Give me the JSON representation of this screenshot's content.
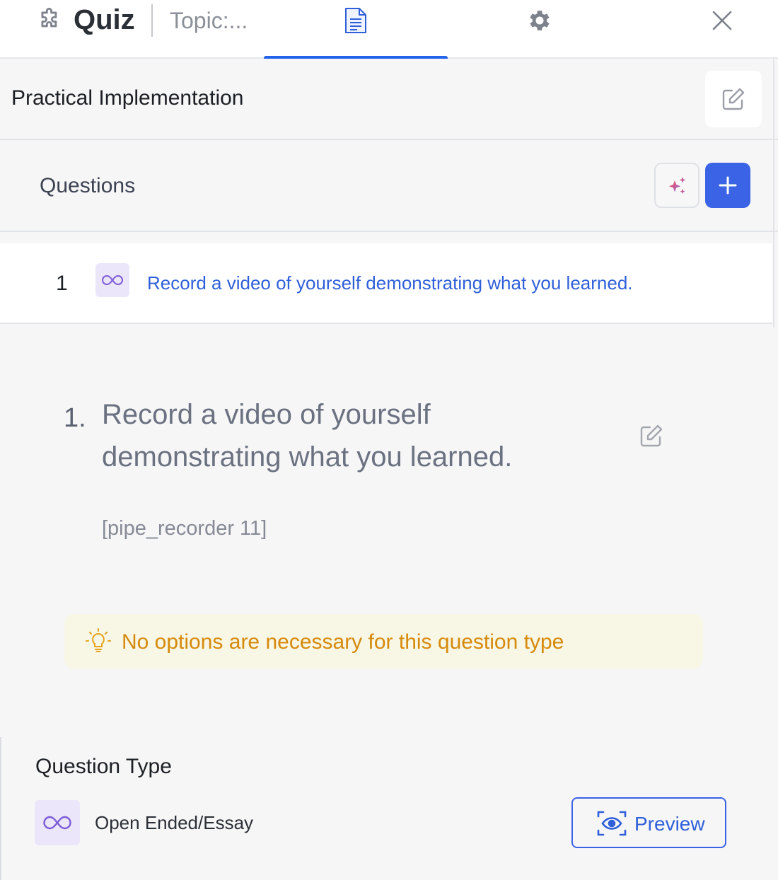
{
  "header": {
    "title": "Quiz",
    "topic": "Topic:...",
    "active_tab": "content",
    "accent_color": "#2563eb"
  },
  "lesson": {
    "title": "Practical Implementation"
  },
  "questions_panel": {
    "label": "Questions",
    "add_button_color": "#3b63e6"
  },
  "question_list": [
    {
      "number": "1",
      "type_icon": "infinity-icon",
      "text": "Record a video of yourself demonstrating what you learned."
    }
  ],
  "question_detail": {
    "number": "1.",
    "title": "Record a video of yourself demonstrating what you learned.",
    "shortcode": "[pipe_recorder 11]"
  },
  "notice": {
    "icon": "lightbulb-icon",
    "text": "No options are necessary for this question type",
    "color": "#d68a0c"
  },
  "question_type": {
    "label": "Question Type",
    "value": "Open Ended/Essay",
    "icon": "infinity-icon",
    "preview_label": "Preview"
  }
}
